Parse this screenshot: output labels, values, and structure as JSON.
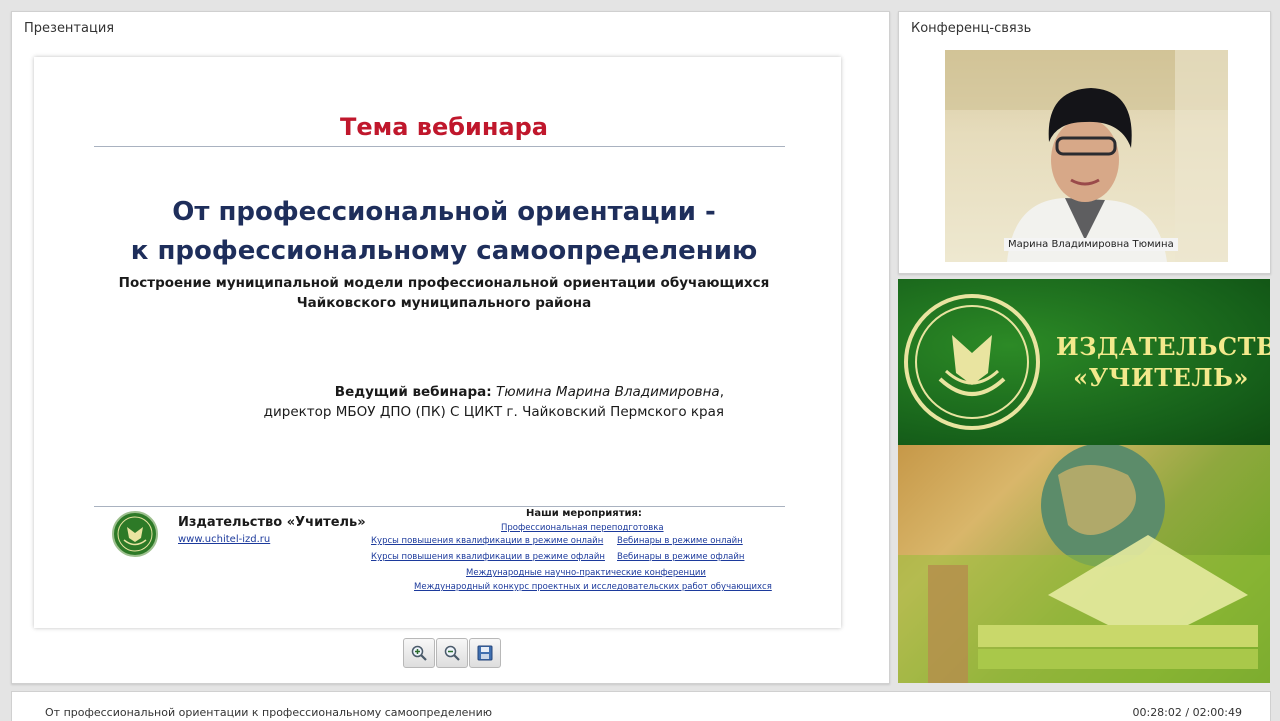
{
  "presentation": {
    "panel_title": "Презентация",
    "slide": {
      "heading": "Тема вебинара",
      "title_line1": "От профессиональной ориентации -",
      "title_line2": "к профессиональному самоопределению",
      "subtitle_line1": "Построение муниципальной модели профессиональной ориентации обучающихся",
      "subtitle_line2": "Чайковского муниципального района",
      "host_label": "Ведущий вебинара:",
      "host_name": "Тюмина Марина Владимировна",
      "host_position": "директор МБОУ ДПО (ПК) С ЦИКТ г. Чайковский Пермского края",
      "publisher_name": "Издательство «Учитель»",
      "publisher_site": "www.uchitel-izd.ru",
      "events_heading": "Наши мероприятия:",
      "events": [
        "Профессиональная переподготовка",
        "Курсы повышения квалификации в режиме онлайн",
        "Вебинары в режиме онлайн",
        "Курсы повышения квалификации в режиме офлайн",
        "Вебинары в режиме офлайн",
        "Международные научно-практические конференции",
        "Международный конкурс проектных и исследовательских работ обучающихся"
      ]
    },
    "toolbar": [
      "zoom-in-icon",
      "zoom-out-icon",
      "save-icon"
    ]
  },
  "conference": {
    "panel_title": "Конференц-связь",
    "speaker_name": "Марина Владимировна Тюмина"
  },
  "ad": {
    "line1": "ИЗДАТЕЛЬСТВО",
    "line2": "«УЧИТЕЛЬ»"
  },
  "status": {
    "title": "От профессиональной ориентации к профессиональному самоопределению",
    "time": "00:28:02 / 02:00:49"
  },
  "colors": {
    "heading_red": "#c0172c",
    "title_navy": "#1e2e5b",
    "link_blue": "#1c3a9c",
    "brand_green": "#16601a",
    "brand_gold": "#f3e98c"
  }
}
